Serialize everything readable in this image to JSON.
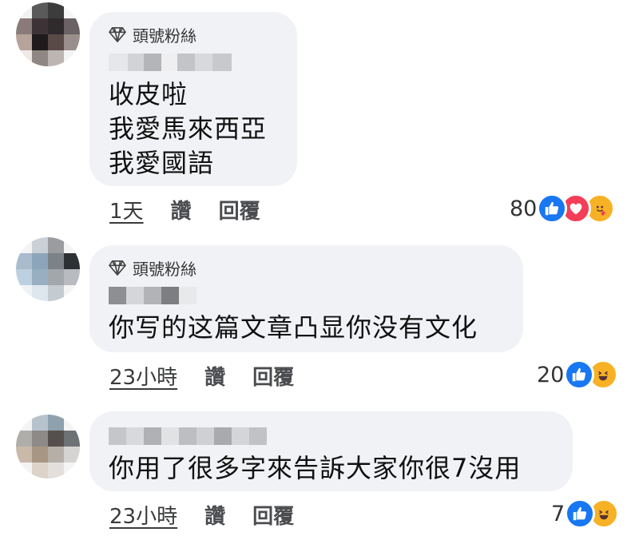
{
  "comments": [
    {
      "badge": "頭號粉絲",
      "lines": [
        "收皮啦",
        "我愛馬來西亞",
        "我愛國語"
      ],
      "time": "1天",
      "like": "讚",
      "reply": "回覆",
      "reaction_count": "80",
      "reactions": [
        "like-icon",
        "love-icon",
        "care-icon"
      ]
    },
    {
      "badge": "頭號粉絲",
      "lines": [
        "你写的这篇文章凸显你没有文化"
      ],
      "time": "23小時",
      "like": "讚",
      "reply": "回覆",
      "reaction_count": "20",
      "reactions": [
        "like-icon",
        "haha-icon"
      ]
    },
    {
      "lines": [
        "你用了很多字來告訴大家你很7沒用"
      ],
      "time": "23小時",
      "like": "讚",
      "reply": "回覆",
      "reaction_count": "7",
      "reactions": [
        "like-icon",
        "haha-icon"
      ]
    }
  ],
  "colors": {
    "bubble": "#f0f2f5",
    "like": "#1877f2",
    "love": "#f33e58",
    "care": "#f7b125",
    "haha": "#f7b125"
  }
}
